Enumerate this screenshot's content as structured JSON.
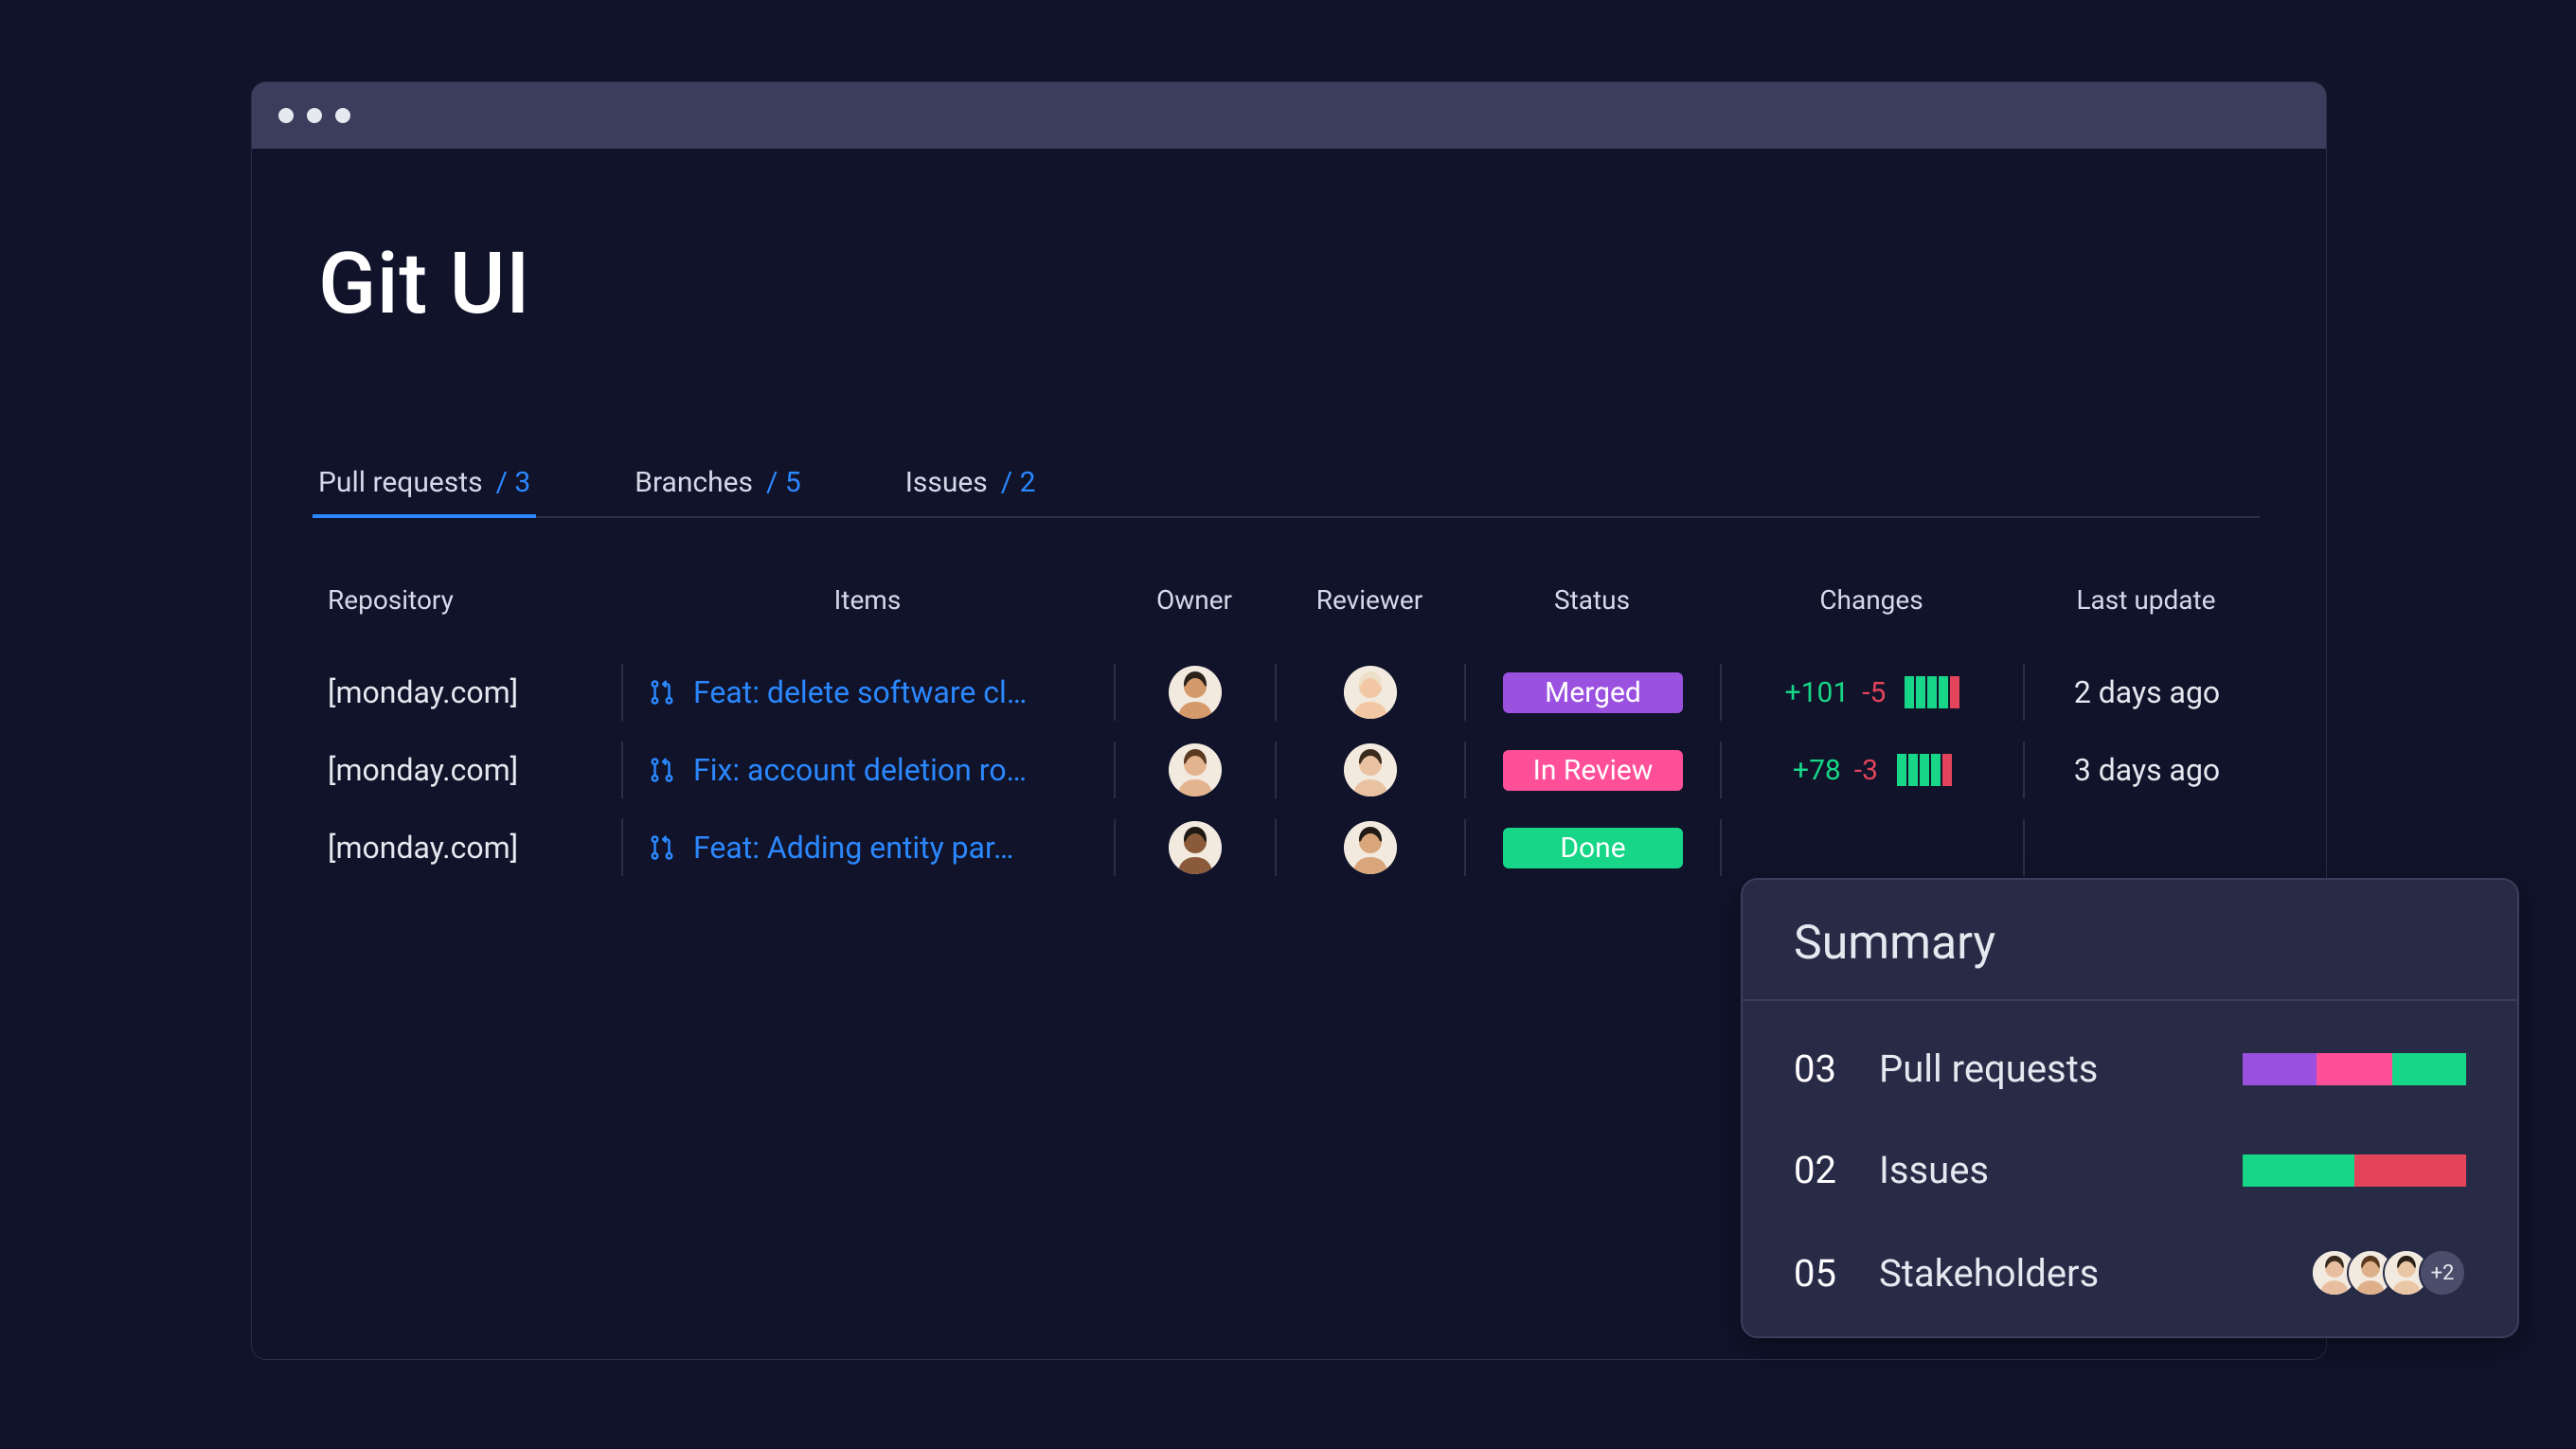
{
  "header": {
    "title": "Git UI"
  },
  "tabs": [
    {
      "label": "Pull requests",
      "count": "/ 3",
      "active": true
    },
    {
      "label": "Branches",
      "count": "/ 5",
      "active": false
    },
    {
      "label": "Issues",
      "count": "/ 2",
      "active": false
    }
  ],
  "columns": {
    "repository": "Repository",
    "items": "Items",
    "owner": "Owner",
    "reviewer": "Reviewer",
    "status": "Status",
    "changes": "Changes",
    "last_update": "Last update"
  },
  "rows": [
    {
      "repo": "[monday.com]",
      "item": "Feat: delete software cl…",
      "status": {
        "label": "Merged",
        "color": "#9b51e0"
      },
      "changes": {
        "add": "+101",
        "del": "-5",
        "bars": [
          "#17d687",
          "#17d687",
          "#17d687",
          "#17d687",
          "#e4445b"
        ]
      },
      "last_update": "2 days ago"
    },
    {
      "repo": "[monday.com]",
      "item": "Fix: account deletion ro…",
      "status": {
        "label": "In Review",
        "color": "#ff4f99"
      },
      "changes": {
        "add": "+78",
        "del": "-3",
        "bars": [
          "#17d687",
          "#17d687",
          "#17d687",
          "#17d687",
          "#e4445b"
        ]
      },
      "last_update": "3 days ago"
    },
    {
      "repo": "[monday.com]",
      "item": "Feat: Adding entity par…",
      "status": {
        "label": "Done",
        "color": "#17d687"
      },
      "changes": null,
      "last_update": ""
    }
  ],
  "avatars": {
    "owner0": {
      "skin": "#d49a6a",
      "hair": "#2b221b"
    },
    "reviewer0": {
      "skin": "#f1c8a3",
      "hair": "#ede0c8"
    },
    "owner1": {
      "skin": "#e4b48f",
      "hair": "#5b3a22"
    },
    "reviewer1": {
      "skin": "#e9c3a1",
      "hair": "#3a2b1d"
    },
    "owner2": {
      "skin": "#8a5a3a",
      "hair": "#1e1812"
    },
    "reviewer2": {
      "skin": "#d9a57a",
      "hair": "#201a15"
    }
  },
  "summary": {
    "title": "Summary",
    "rows": [
      {
        "num": "03",
        "label": "Pull requests",
        "bar": [
          {
            "color": "#9b51e0",
            "pct": 33
          },
          {
            "color": "#ff4f99",
            "pct": 34
          },
          {
            "color": "#17d687",
            "pct": 33
          }
        ]
      },
      {
        "num": "02",
        "label": "Issues",
        "bar": [
          {
            "color": "#17d687",
            "pct": 50
          },
          {
            "color": "#e4445b",
            "pct": 50
          }
        ]
      },
      {
        "num": "05",
        "label": "Stakeholders",
        "more": "+2"
      }
    ],
    "stakeholder_avatars": [
      {
        "skin": "#e7bfa0",
        "hair": "#3a2a1b"
      },
      {
        "skin": "#deb08a",
        "hair": "#5a3a1f"
      },
      {
        "skin": "#e9c7a6",
        "hair": "#2b2118"
      }
    ]
  }
}
